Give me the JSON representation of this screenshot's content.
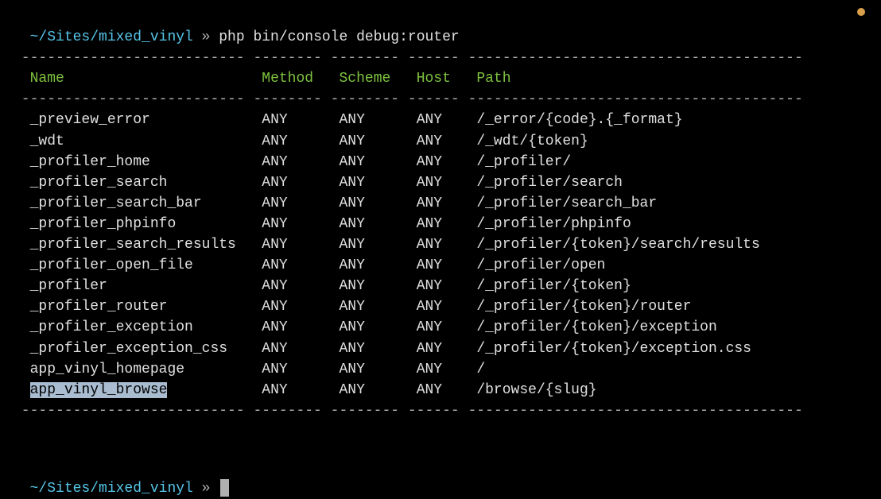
{
  "prompt1": {
    "path": "~/Sites/mixed_vinyl",
    "sep": " » ",
    "cmd": "php bin/console debug:router"
  },
  "dashes": {
    "top": " -------------------------- -------- -------- ------ --------------------------------------- ",
    "mid": " -------------------------- -------- -------- ------ --------------------------------------- ",
    "bottom": " -------------------------- -------- -------- ------ --------------------------------------- "
  },
  "headers": {
    "name": "Name",
    "method": "Method",
    "scheme": "Scheme",
    "host": "Host",
    "path": "Path"
  },
  "routes": [
    {
      "name": "_preview_error",
      "method": "ANY",
      "scheme": "ANY",
      "host": "ANY",
      "path": "/_error/{code}.{_format}",
      "highlight": false
    },
    {
      "name": "_wdt",
      "method": "ANY",
      "scheme": "ANY",
      "host": "ANY",
      "path": "/_wdt/{token}",
      "highlight": false
    },
    {
      "name": "_profiler_home",
      "method": "ANY",
      "scheme": "ANY",
      "host": "ANY",
      "path": "/_profiler/",
      "highlight": false
    },
    {
      "name": "_profiler_search",
      "method": "ANY",
      "scheme": "ANY",
      "host": "ANY",
      "path": "/_profiler/search",
      "highlight": false
    },
    {
      "name": "_profiler_search_bar",
      "method": "ANY",
      "scheme": "ANY",
      "host": "ANY",
      "path": "/_profiler/search_bar",
      "highlight": false
    },
    {
      "name": "_profiler_phpinfo",
      "method": "ANY",
      "scheme": "ANY",
      "host": "ANY",
      "path": "/_profiler/phpinfo",
      "highlight": false
    },
    {
      "name": "_profiler_search_results",
      "method": "ANY",
      "scheme": "ANY",
      "host": "ANY",
      "path": "/_profiler/{token}/search/results",
      "highlight": false
    },
    {
      "name": "_profiler_open_file",
      "method": "ANY",
      "scheme": "ANY",
      "host": "ANY",
      "path": "/_profiler/open",
      "highlight": false
    },
    {
      "name": "_profiler",
      "method": "ANY",
      "scheme": "ANY",
      "host": "ANY",
      "path": "/_profiler/{token}",
      "highlight": false
    },
    {
      "name": "_profiler_router",
      "method": "ANY",
      "scheme": "ANY",
      "host": "ANY",
      "path": "/_profiler/{token}/router",
      "highlight": false
    },
    {
      "name": "_profiler_exception",
      "method": "ANY",
      "scheme": "ANY",
      "host": "ANY",
      "path": "/_profiler/{token}/exception",
      "highlight": false
    },
    {
      "name": "_profiler_exception_css",
      "method": "ANY",
      "scheme": "ANY",
      "host": "ANY",
      "path": "/_profiler/{token}/exception.css",
      "highlight": false
    },
    {
      "name": "app_vinyl_homepage",
      "method": "ANY",
      "scheme": "ANY",
      "host": "ANY",
      "path": "/",
      "highlight": false
    },
    {
      "name": "app_vinyl_browse",
      "method": "ANY",
      "scheme": "ANY",
      "host": "ANY",
      "path": "/browse/{slug}",
      "highlight": true
    }
  ],
  "prompt2": {
    "path": "~/Sites/mixed_vinyl",
    "sep": " » "
  },
  "cols": {
    "name": 27,
    "method": 9,
    "scheme": 9,
    "host": 7
  }
}
